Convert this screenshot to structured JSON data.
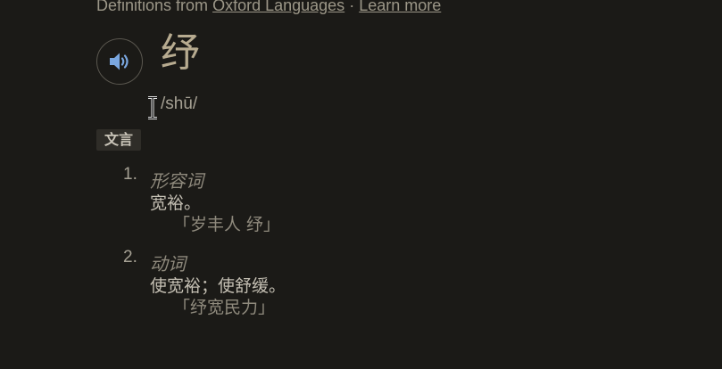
{
  "source": {
    "prefix": "Definitions from",
    "provider_link": "Oxford Languages",
    "separator": "·",
    "learn_more_link": "Learn more"
  },
  "entry": {
    "headword": "纾",
    "pronunciation": "/shū/",
    "register": "文言"
  },
  "senses": [
    {
      "number": "1.",
      "pos": "形容词",
      "gloss": "宽裕。",
      "example": "「岁丰人 纾」"
    },
    {
      "number": "2.",
      "pos": "动词",
      "gloss": "使宽裕；使舒缓。",
      "example": "「纾宽民力」"
    }
  ],
  "icons": {
    "audio": "speaker-icon",
    "cursor": "text-cursor-icon"
  },
  "colors": {
    "background": "#1b1a17",
    "speaker": "#7aa7e0"
  }
}
